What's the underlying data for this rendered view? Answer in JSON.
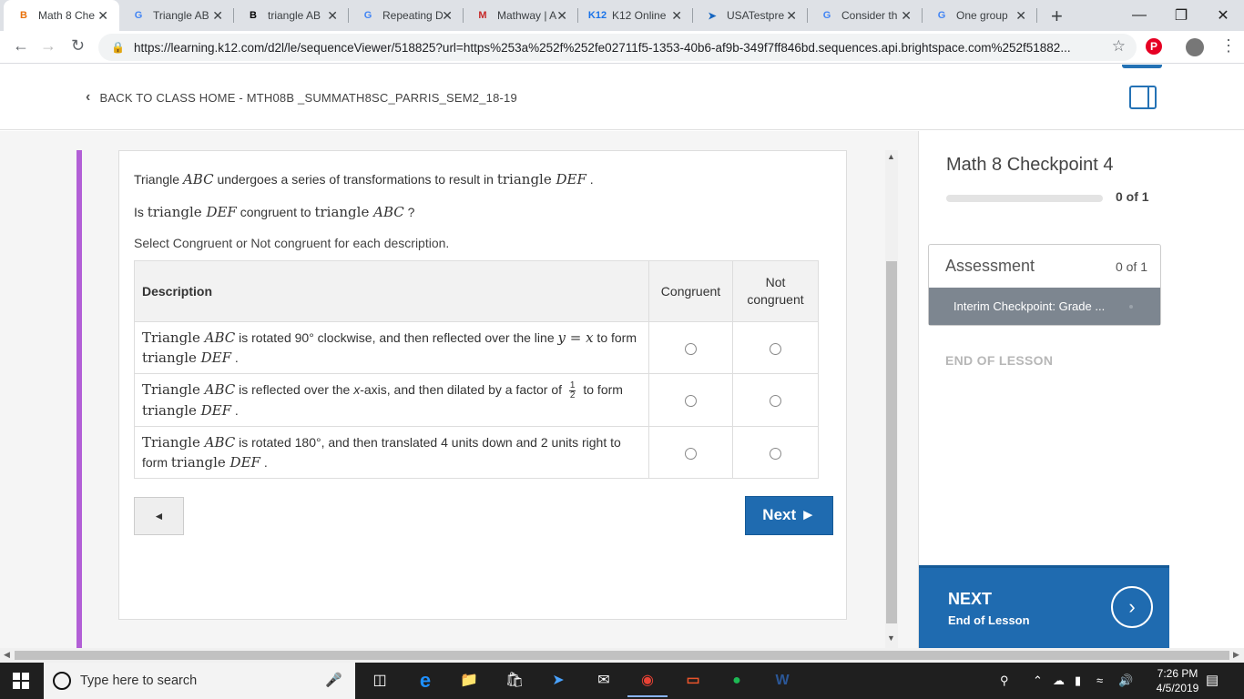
{
  "browser": {
    "tabs": [
      {
        "title": "Math 8 Che",
        "favicon": "brightspace-icon",
        "fav_text": "B",
        "fav_color": "#e8710a",
        "active": true
      },
      {
        "title": "Triangle AB",
        "favicon": "google-icon",
        "fav_text": "G",
        "fav_color": "#4285f4"
      },
      {
        "title": "triangle AB",
        "favicon": "brainly-icon",
        "fav_text": "B",
        "fav_color": "#000000"
      },
      {
        "title": "Repeating D",
        "favicon": "google-icon",
        "fav_text": "G",
        "fav_color": "#4285f4"
      },
      {
        "title": "Mathway | A",
        "favicon": "mathway-icon",
        "fav_text": "M",
        "fav_color": "#c62828"
      },
      {
        "title": "K12 Online",
        "favicon": "k12-icon",
        "fav_text": "K12",
        "fav_color": "#1a73e8"
      },
      {
        "title": "USATestpre",
        "favicon": "cursor-icon",
        "fav_text": "➤",
        "fav_color": "#1565c0"
      },
      {
        "title": "Consider th",
        "favicon": "google-icon",
        "fav_text": "G",
        "fav_color": "#4285f4"
      },
      {
        "title": "One group",
        "favicon": "google-icon",
        "fav_text": "G",
        "fav_color": "#4285f4"
      }
    ],
    "url": "https://learning.k12.com/d2l/le/sequenceViewer/518825?url=https%253a%252f%252fe02711f5-1353-40b6-af9b-349f7ff846bd.sequences.api.brightspace.com%252f51882..."
  },
  "header": {
    "back_label": "BACK TO CLASS HOME - MTH08B _SUMMATH8SC_PARRIS_SEM2_18-19"
  },
  "question": {
    "line1_pre": "Triangle ",
    "line1_abc": "ABC",
    "line1_mid": " undergoes a series of transformations to result in ",
    "line1_tri": "triangle ",
    "line1_def": "DEF",
    "line1_end": " .",
    "line2_pre": "Is ",
    "line2_tri1": "triangle ",
    "line2_def": "DEF",
    "line2_mid": " congruent to ",
    "line2_tri2": "triangle ",
    "line2_abc": "ABC",
    "line2_end": " ?",
    "instruction": "Select Congruent or Not congruent for each description.",
    "table": {
      "col_description": "Description",
      "col_congruent": "Congruent",
      "col_not": "Not congruent",
      "rows": [
        {
          "a": "Triangle ",
          "b": "ABC",
          "c": " is rotated 90° clockwise, and then reflected over the line ",
          "eq": "y = x",
          "d": " to form ",
          "e": "triangle ",
          "f": "DEF",
          "g": " ."
        },
        {
          "a": "Triangle ",
          "b": "ABC",
          "c": " is reflected over the ",
          "eq": "x",
          "d": "-axis, and then dilated by a factor of ",
          "num": "1",
          "den": "2",
          "d2": " to form ",
          "e": "triangle ",
          "f": "DEF",
          "g": " ."
        },
        {
          "a": "Triangle ",
          "b": "ABC",
          "c": " is rotated 180°, and then translated 4 units down and 2 units right to form ",
          "e": "triangle ",
          "f": "DEF",
          "g": " ."
        }
      ]
    },
    "prev_label": "◄",
    "next_label": "Next ►"
  },
  "sidebar": {
    "lesson_title": "Math 8 Checkpoint 4",
    "progress_text": "0 of 1",
    "progress_value": 0,
    "assessment_title": "Assessment",
    "assessment_count": "0 of 1",
    "assessment_item": "Interim Checkpoint: Grade ...",
    "end_of_lesson": "END OF LESSON",
    "next_label": "NEXT",
    "next_sub": "End of Lesson"
  },
  "taskbar": {
    "search_placeholder": "Type here to search",
    "time": "7:26 PM",
    "date": "4/5/2019"
  }
}
